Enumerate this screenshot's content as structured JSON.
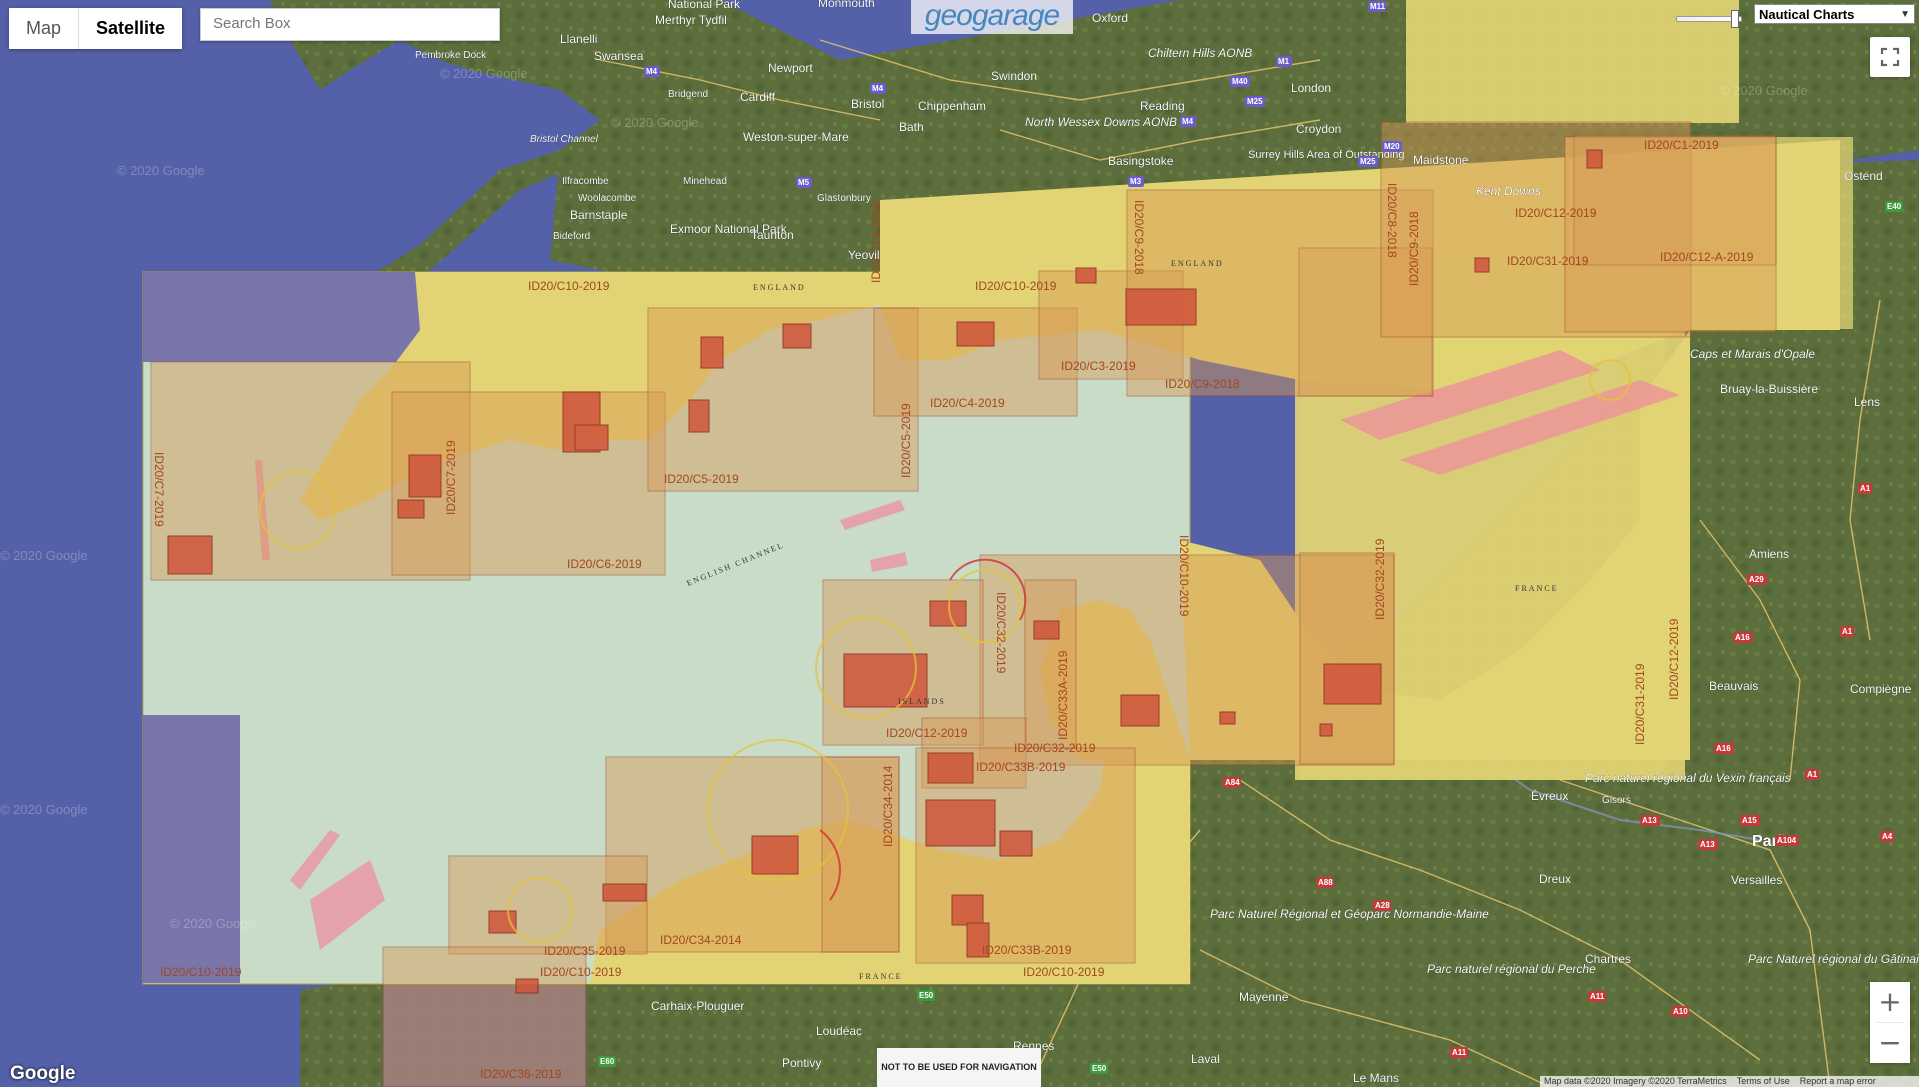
{
  "map_type_control": {
    "map_label": "Map",
    "satellite_label": "Satellite",
    "active": "Satellite"
  },
  "search": {
    "placeholder": "Search Box"
  },
  "logo": {
    "text": "geogarage"
  },
  "overlay_selector": {
    "selected": "Nautical Charts"
  },
  "opacity": {
    "level": 0.95
  },
  "zoom": {
    "in_label": "+",
    "out_label": "−"
  },
  "notice": "NOT TO BE USED FOR NAVIGATION",
  "attribution": {
    "map_data": "Map data ©2020 Imagery ©2020 TerraMetrics",
    "terms": "Terms of Use",
    "report": "Report a map error"
  },
  "google_logo": "Google",
  "colors": {
    "sea": "#5461a8",
    "land": "#5a6f3a",
    "chart_yellow": "#e6d66e",
    "chart_water": "#c8dcc8",
    "chart_orange": "#e49a3c",
    "chart_red": "#c0493b",
    "label": "#a4461e"
  },
  "chart_labels": [
    "ID20/C10-2019",
    "ID20/C10-2019",
    "ID20/C10-2019",
    "ID20/C10-2019",
    "ID20/C10-2019",
    "ID20/C7-2019",
    "ID20/C7-2019",
    "ID20/C6-2019",
    "ID20/C5-2019",
    "ID20/C5-2019",
    "ID20/C4-2019",
    "ID20/C3-2019",
    "ID20/C9-2018",
    "ID20/C9-2018",
    "ID20/C9-2018",
    "ID20/C8-2018",
    "ID20/C31-2019",
    "ID20/C31-2019",
    "ID20/C12-2019",
    "ID20/C12-2019",
    "ID20/C12-2019",
    "ID20/C1-2019",
    "ID20/C12-A-2019",
    "ID20/C12-2019",
    "ID20/C32-2019",
    "ID20/C32-2019",
    "ID20/C33A-2019",
    "ID20/C33B-2019",
    "ID20/C33B-2019",
    "ID20/C34-2014",
    "ID20/C34-2014",
    "ID20/C35-2019",
    "ID20/C36-2019",
    "ID20/C32-2019",
    "ID20/C10-2019"
  ],
  "chart_text": [
    "ENGLAND",
    "ENGLAND",
    "ENGLISH CHANNEL",
    "FRANCE",
    "FRANCE",
    "ISLANDS"
  ],
  "place_labels": [
    "National Park",
    "Merthyr Tydfil",
    "Monmouth",
    "Oxford",
    "Llanelli",
    "Swansea",
    "Newport",
    "Swindon",
    "London",
    "Pembroke Dock",
    "Bridgend",
    "Cardiff",
    "Bristol",
    "Chippenham",
    "Reading",
    "Bath",
    "Weston-super-Mare",
    "North Wessex Downs AONB",
    "Chiltern Hills AONB",
    "Croydon",
    "Bristol Channel",
    "Minehead",
    "Ilfracombe",
    "Woolacombe",
    "Barnstaple",
    "Bideford",
    "Exmoor National Park",
    "Taunton",
    "Glastonbury",
    "Yeovil",
    "Basingstoke",
    "Surrey Hills Area of Outstanding",
    "Maidstone",
    "Kent Downs",
    "Ostend",
    "Caps et Marais d'Opale",
    "Bruay-la-Buissière",
    "Lens",
    "Amiens",
    "Compiègne",
    "Beauvais",
    "Parc naturel régional du Vexin français",
    "Évreux",
    "Gisors",
    "Paris",
    "Versailles",
    "Dreux",
    "Parc Naturel Régional et Géoparc Normandie-Maine",
    "Chartres",
    "Parc naturel régional du Perche",
    "Parc Naturel régional du Gâtinais Français",
    "Mayenne",
    "Laval",
    "Rennes",
    "Carhaix-Plouguer",
    "Loudéac",
    "Pontivy",
    "Le Mans"
  ],
  "road_badges": [
    "M4",
    "M4",
    "M5",
    "M4",
    "M3",
    "M40",
    "M25",
    "M1",
    "M11",
    "M20",
    "M25",
    "E40",
    "A1",
    "A29",
    "A16",
    "A16",
    "A1",
    "A1",
    "A13",
    "A15",
    "A13",
    "A104",
    "A4",
    "A84",
    "A88",
    "A28",
    "A11",
    "A10",
    "A11",
    "E50",
    "E60",
    "E50"
  ],
  "watermarks": [
    "© 2020 Google",
    "© 2020 Google",
    "© 2020 Google",
    "© 2020 Google",
    "© 2020 Google",
    "© 2020 Google",
    "© 2020 Google"
  ]
}
